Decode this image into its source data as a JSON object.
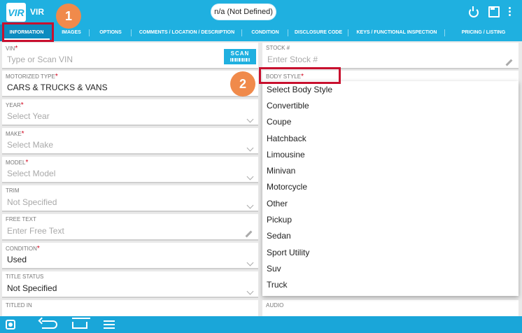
{
  "app": {
    "logo_text": "VIR",
    "title": "VIR",
    "vehicle_pill": "n/a (Not Defined)"
  },
  "toolbar": {
    "icons": [
      "power-icon",
      "save-icon",
      "more-vert-icon"
    ]
  },
  "tabs": [
    {
      "label": "INFORMATION",
      "active": true
    },
    {
      "label": "IMAGES"
    },
    {
      "label": "OPTIONS"
    },
    {
      "label": "COMMENTS / LOCATION / DESCRIPTION"
    },
    {
      "label": "CONDITION"
    },
    {
      "label": "DISCLOSURE CODE"
    },
    {
      "label": "KEYS / FUNCTIONAL INSPECTION"
    },
    {
      "label": "PRICING / LISTING"
    }
  ],
  "left_fields": {
    "vin": {
      "label": "VIN",
      "placeholder": "Type or Scan VIN",
      "scan_label": "SCAN"
    },
    "motorized_type": {
      "label": "MOTORIZED TYPE",
      "value": "CARS & TRUCKS & VANS"
    },
    "year": {
      "label": "YEAR",
      "placeholder": "Select Year"
    },
    "make": {
      "label": "MAKE",
      "placeholder": "Select Make"
    },
    "model": {
      "label": "MODEL",
      "placeholder": "Select Model"
    },
    "trim": {
      "label": "TRIM",
      "placeholder": "Not Specified"
    },
    "free_text": {
      "label": "FREE TEXT",
      "placeholder": "Enter Free Text"
    },
    "condition": {
      "label": "CONDITION",
      "value": "Used"
    },
    "title_status": {
      "label": "TITLE STATUS",
      "value": "Not Specified"
    },
    "titled_in": {
      "label": "TITLED IN"
    }
  },
  "right_fields": {
    "stock": {
      "label": "STOCK #",
      "placeholder": "Enter Stock #"
    },
    "body_style": {
      "label": "BODY STYLE"
    },
    "audio": {
      "label": "AUDIO"
    }
  },
  "body_style_options": [
    "Select Body Style",
    "Convertible",
    "Coupe",
    "Hatchback",
    "Limousine",
    "Minivan",
    "Motorcycle",
    "Other",
    "Pickup",
    "Sedan",
    "Sport Utility",
    "Suv",
    "Truck"
  ],
  "callouts": {
    "step1": "1",
    "step2": "2"
  },
  "required_mark": "*",
  "colors": {
    "primary": "#1fb0e0",
    "highlight": "#c8102e",
    "callout": "#f08a4b"
  }
}
